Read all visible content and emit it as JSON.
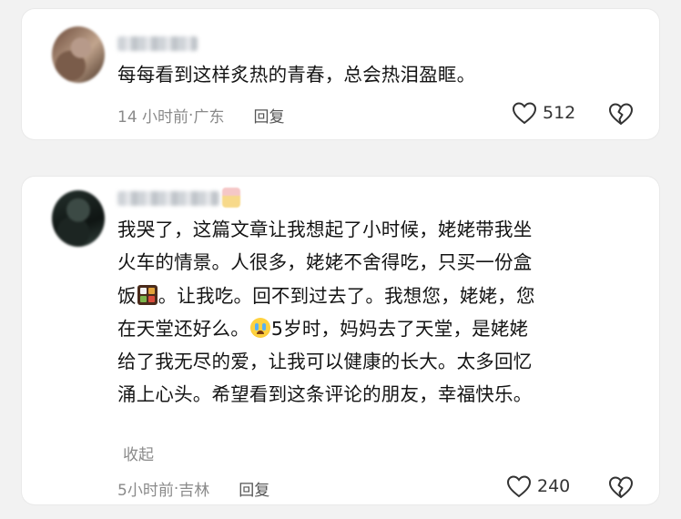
{
  "comments": [
    {
      "text_lines": [
        "每每看到这样炙热的青春，总会热泪盈眶。"
      ],
      "time": "14 小时前",
      "separator": " · ",
      "location": "广东",
      "reply_label": "回复",
      "likes": "512",
      "icons": {
        "like": "heart-outline-icon",
        "dislike": "broken-heart-icon"
      }
    },
    {
      "text_segments": {
        "l1": "我哭了，这篇文章让我想起了小时候，姥姥带我坐",
        "l2": "火车的情景。人很多，姥姥不舍得吃，只买一份盒",
        "l3a": "饭",
        "l3b": "。让我吃。回不到过去了。我想您，姥姥，您",
        "l4a": "在天堂还好么。",
        "l4b": "5岁时，妈妈去了天堂，是姥姥",
        "l5": "给了我无尽的爱，让我可以健康的长大。太多回忆",
        "l6": "涌上心头。希望看到这条评论的朋友，幸福快乐。"
      },
      "emoji": {
        "bento": "bento-box-emoji",
        "cry": "crying-face-emoji"
      },
      "collapse_label": "收起",
      "time": "5小时前",
      "separator": " · ",
      "location": "吉林",
      "reply_label": "回复",
      "likes": "240",
      "icons": {
        "like": "heart-outline-icon",
        "dislike": "broken-heart-icon"
      }
    }
  ],
  "colors": {
    "background": "#f2f2f2",
    "card": "#ffffff",
    "meta": "#8a8a8a",
    "text": "#141414"
  }
}
